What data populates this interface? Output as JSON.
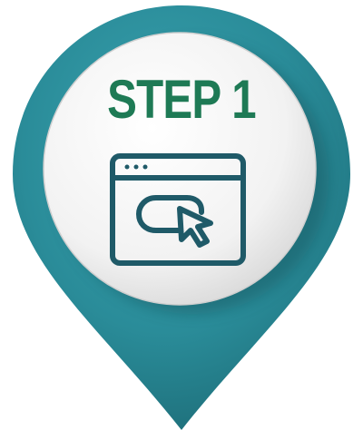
{
  "badge": {
    "title": "STEP 1",
    "icon": "browser-window-click-icon"
  },
  "colors": {
    "pin_teal": "#2a8c99",
    "pin_teal_dark": "#1f6f7a",
    "title_green": "#1e7a55",
    "icon_stroke": "#1f5a68",
    "disc_face": "#f4f4f4"
  }
}
